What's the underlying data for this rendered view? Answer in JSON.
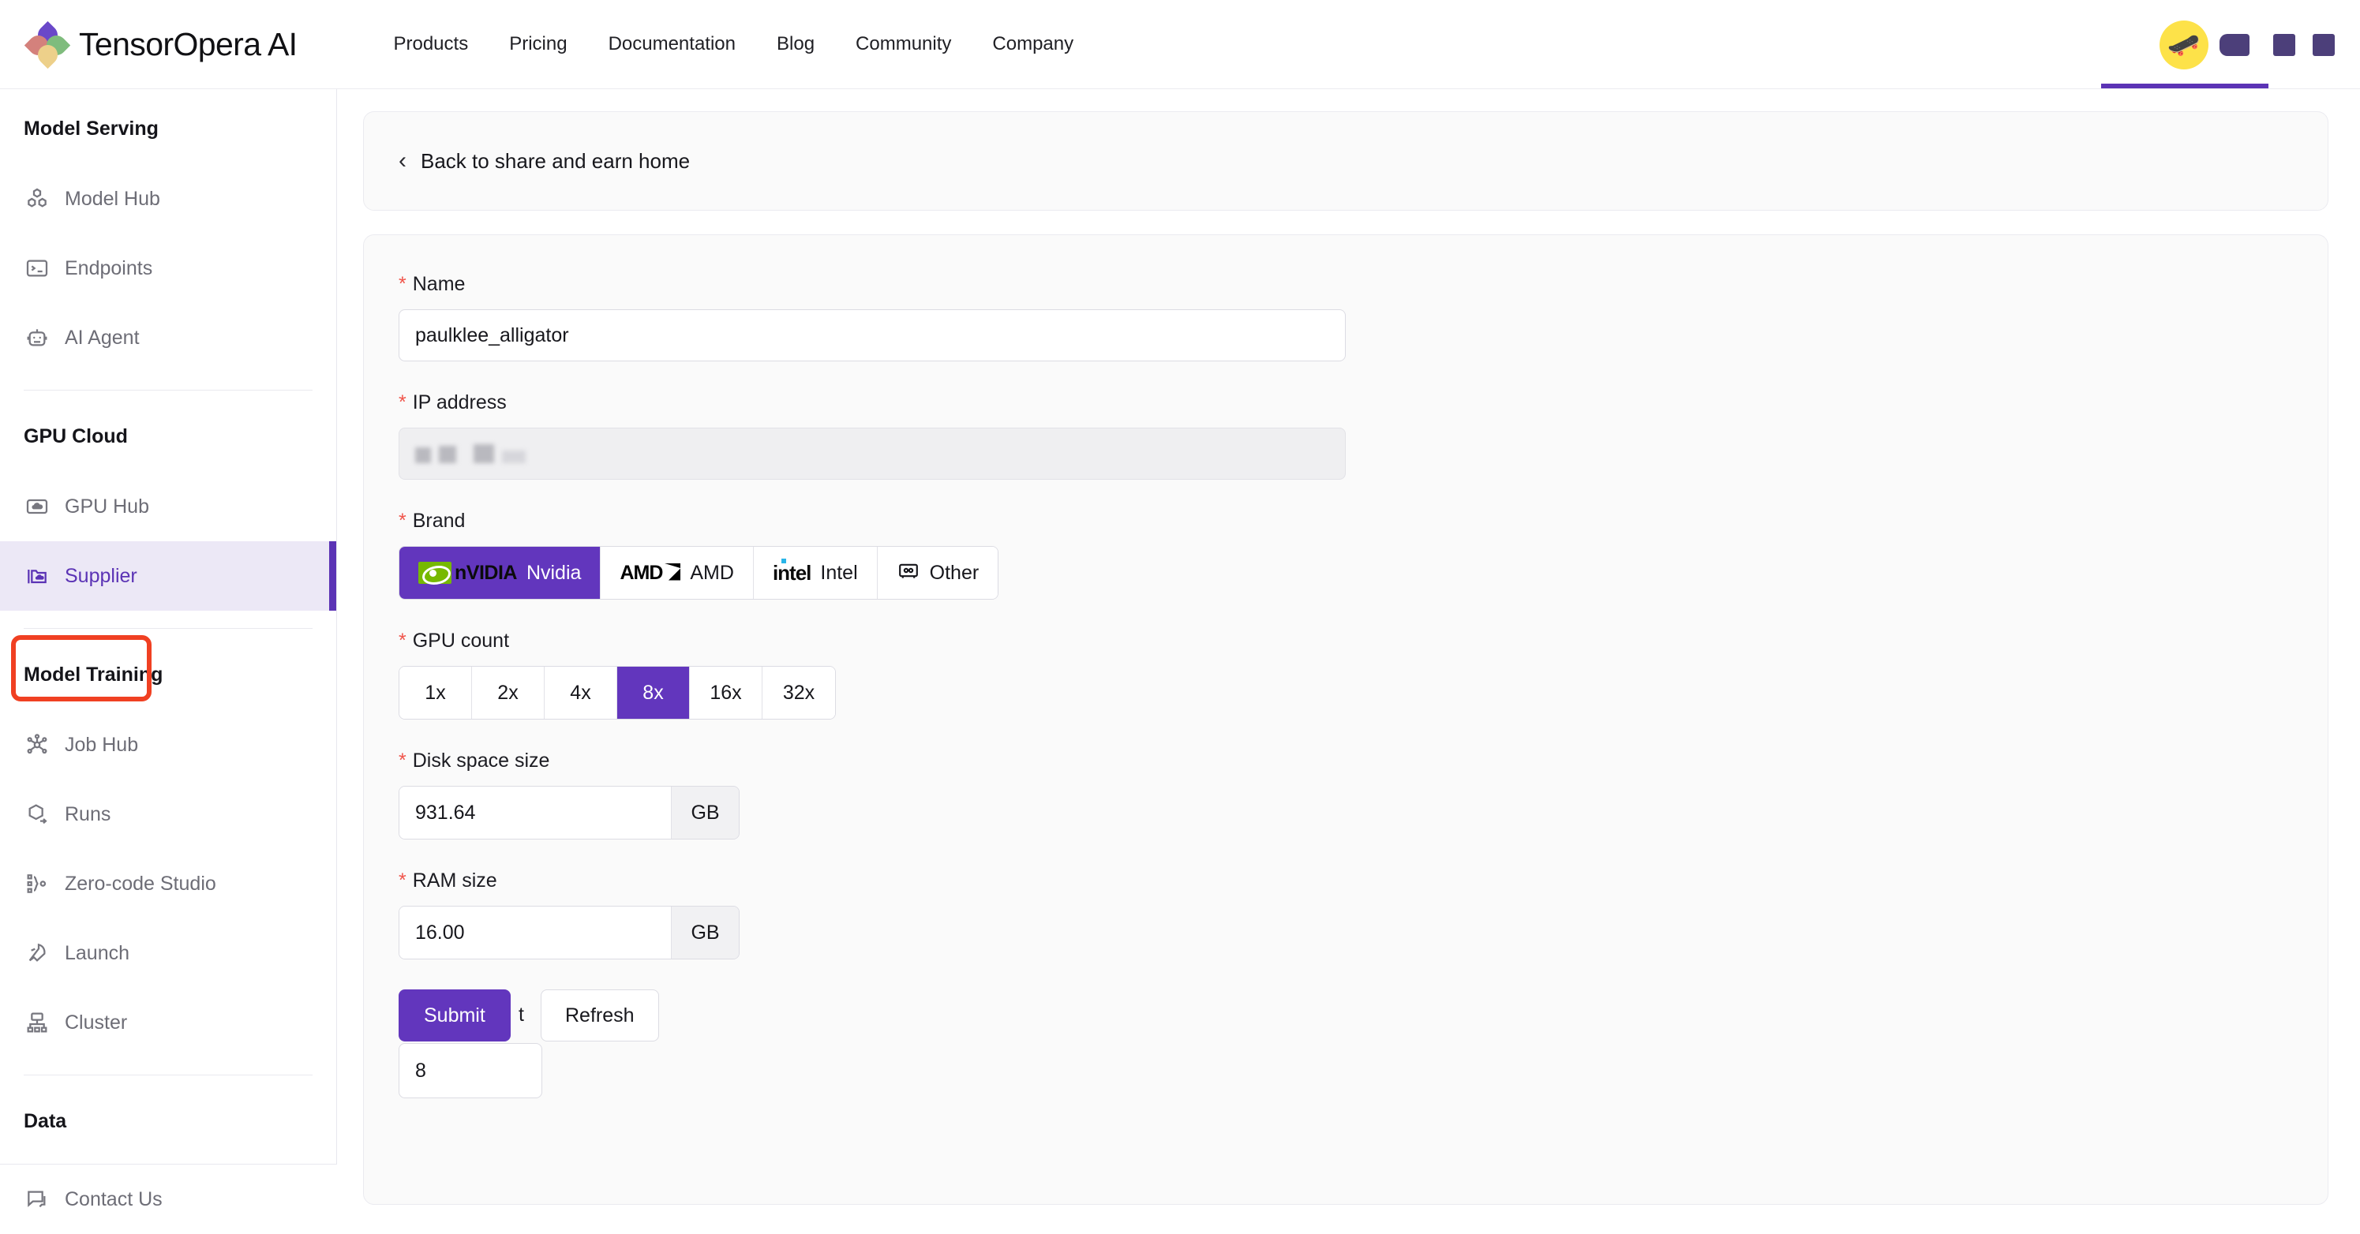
{
  "header": {
    "brand_name": "TensorOpera AI",
    "nav": [
      {
        "label": "Products"
      },
      {
        "label": "Pricing"
      },
      {
        "label": "Documentation"
      },
      {
        "label": "Blog"
      },
      {
        "label": "Community"
      },
      {
        "label": "Company"
      }
    ],
    "avatar_emoji": "🛹",
    "accent_color": "#5b33b5"
  },
  "sidebar": {
    "groups": [
      {
        "title": "Model Serving",
        "items": [
          {
            "label": "Model Hub",
            "icon": "cubes-icon",
            "active": false
          },
          {
            "label": "Endpoints",
            "icon": "terminal-icon",
            "active": false
          },
          {
            "label": "AI Agent",
            "icon": "robot-icon",
            "active": false
          }
        ]
      },
      {
        "title": "GPU Cloud",
        "items": [
          {
            "label": "GPU Hub",
            "icon": "cloud-box-icon",
            "active": false
          },
          {
            "label": "Supplier",
            "icon": "folder-cloud-icon",
            "active": true
          }
        ]
      },
      {
        "title": "Model Training",
        "items": [
          {
            "label": "Job Hub",
            "icon": "nodes-icon",
            "active": false
          },
          {
            "label": "Runs",
            "icon": "cube-arrow-icon",
            "active": false
          },
          {
            "label": "Zero-code Studio",
            "icon": "flow-icon",
            "active": false
          },
          {
            "label": "Launch",
            "icon": "rocket-icon",
            "active": false
          },
          {
            "label": "Cluster",
            "icon": "cluster-icon",
            "active": false
          }
        ]
      },
      {
        "title": "Data",
        "items": []
      }
    ],
    "bottom": {
      "label": "Contact Us",
      "icon": "chat-icon"
    },
    "highlight_color": "#f04022",
    "active_bg": "#ece8f6",
    "active_text": "#5b33b5"
  },
  "main": {
    "back_link": {
      "label": "Back to share and earn home",
      "icon": "chevron-left-icon"
    },
    "form": {
      "name": {
        "label": "Name",
        "required_mark": "*",
        "value": "paulklee_alligator"
      },
      "ip_address": {
        "label": "IP address",
        "required_mark": "*",
        "value": "",
        "redacted": true
      },
      "brand": {
        "label": "Brand",
        "required_mark": "*",
        "selected": "Nvidia",
        "options": [
          {
            "label": "Nvidia",
            "icon": "nvidia-logo-icon"
          },
          {
            "label": "AMD",
            "icon": "amd-logo-icon"
          },
          {
            "label": "Intel",
            "icon": "intel-logo-icon"
          },
          {
            "label": "Other",
            "icon": "chip-icon"
          }
        ]
      },
      "gpu_count": {
        "label": "GPU count",
        "required_mark": "*",
        "selected": "8x",
        "options": [
          "1x",
          "2x",
          "4x",
          "8x",
          "16x",
          "32x"
        ]
      },
      "disk_space": {
        "label": "Disk space size",
        "required_mark": "*",
        "value": "931.64",
        "unit": "GB"
      },
      "ram_size": {
        "label": "RAM size",
        "required_mark": "*",
        "value": "16.00",
        "unit": "GB"
      },
      "obscured_label": "t",
      "extra_count": {
        "value": "8"
      },
      "submit_label": "Submit",
      "refresh_label": "Refresh"
    }
  }
}
